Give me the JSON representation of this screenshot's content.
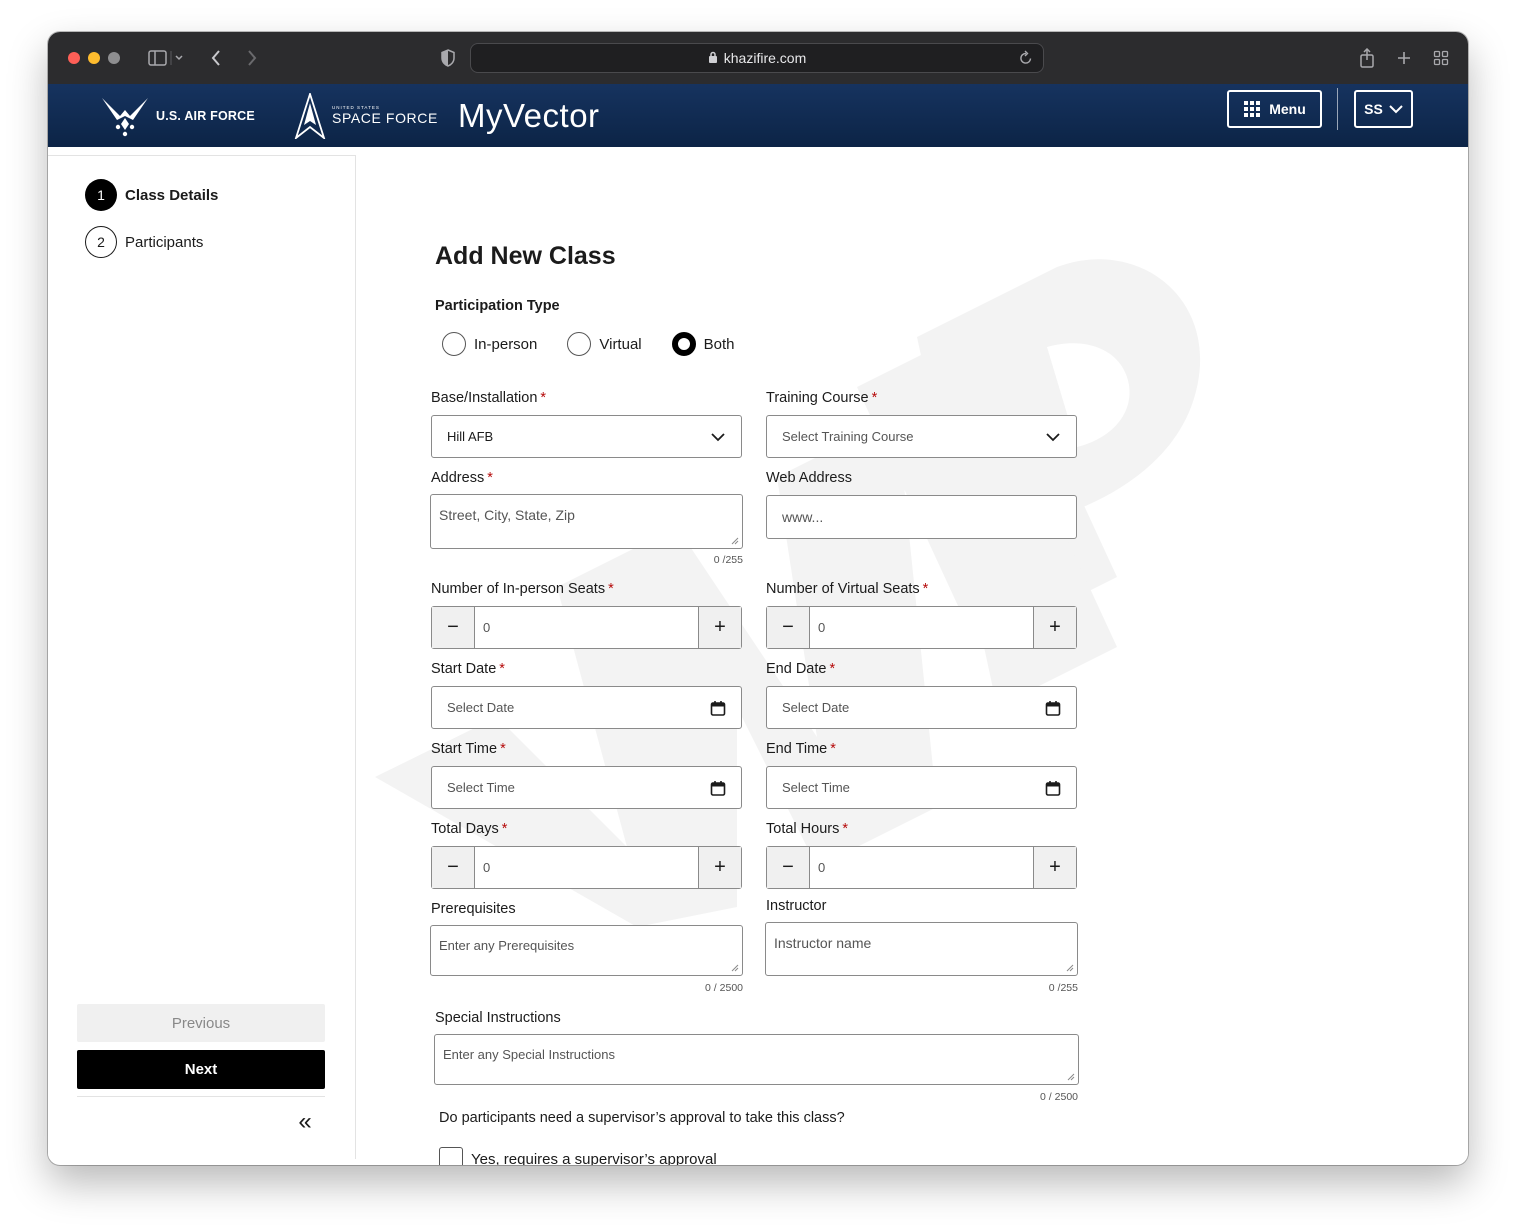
{
  "browser": {
    "url": "khazifire.com"
  },
  "header": {
    "air_force": "U.S. AIR FORCE",
    "space_force_small": "UNITED STATES",
    "space_force": "SPACE FORCE",
    "app_name": "MyVector",
    "menu_label": "Menu",
    "user_initials": "SS"
  },
  "sidebar": {
    "steps": [
      {
        "number": "1",
        "label": "Class Details",
        "active": true
      },
      {
        "number": "2",
        "label": "Participants",
        "active": false
      }
    ],
    "previous_label": "Previous",
    "next_label": "Next"
  },
  "form": {
    "title": "Add New Class",
    "participation_type": {
      "label": "Participation Type",
      "options": [
        "In-person",
        "Virtual",
        "Both"
      ],
      "selected": "Both"
    },
    "base": {
      "label": "Base/Installation",
      "value": "Hill AFB"
    },
    "training_course": {
      "label": "Training Course",
      "placeholder": "Select Training Course"
    },
    "address": {
      "label": "Address",
      "placeholder": "Street, City, State, Zip",
      "counter": "0 /255"
    },
    "web_address": {
      "label": "Web Address",
      "placeholder": "www..."
    },
    "inperson_seats": {
      "label": "Number of In-person Seats",
      "value": "0"
    },
    "virtual_seats": {
      "label": "Number of Virtual Seats",
      "value": "0"
    },
    "start_date": {
      "label": "Start Date",
      "placeholder": "Select Date"
    },
    "end_date": {
      "label": "End Date",
      "placeholder": "Select Date"
    },
    "start_time": {
      "label": "Start Time",
      "placeholder": "Select Time"
    },
    "end_time": {
      "label": "End Time",
      "placeholder": "Select Time"
    },
    "total_days": {
      "label": "Total Days",
      "value": "0"
    },
    "total_hours": {
      "label": "Total Hours",
      "value": "0"
    },
    "prerequisites": {
      "label": "Prerequisites",
      "placeholder": "Enter any Prerequisites",
      "counter": "0 / 2500"
    },
    "instructor": {
      "label": "Instructor",
      "placeholder": "Instructor name",
      "counter": "0 /255"
    },
    "special_instructions": {
      "label": "Special Instructions",
      "placeholder": "Enter any Special Instructions",
      "counter": "0 / 2500"
    },
    "approval_question": "Do participants need a supervisor’s approval to take this class?",
    "approval_checkbox": "Yes, requires a supervisor’s approval",
    "required_marker": "*"
  },
  "colors": {
    "header_bg": "#0c2446",
    "required": "#b50909",
    "primary_button": "#000000"
  }
}
